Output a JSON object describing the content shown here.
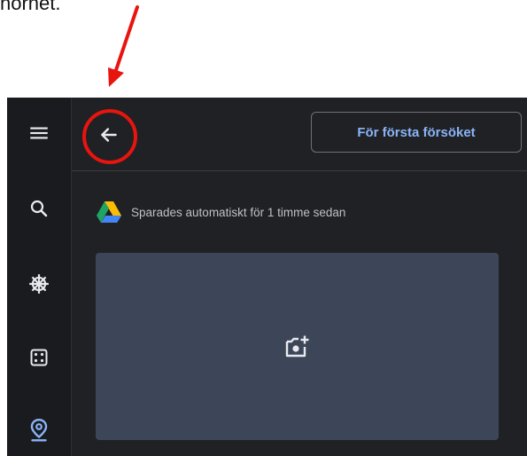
{
  "annotation": {
    "caption_text": "hörnet.",
    "arrow_color": "#e8140f"
  },
  "rail": {
    "items": [
      {
        "icon": "menu-icon"
      },
      {
        "icon": "search-icon"
      },
      {
        "icon": "ship-wheel-icon"
      },
      {
        "icon": "dice-icon"
      },
      {
        "icon": "location-pin-icon",
        "active": true
      }
    ]
  },
  "header": {
    "back_icon": "arrow-left-icon",
    "primary_button_label": "För första försöket"
  },
  "status": {
    "icon": "google-drive-icon",
    "text": "Sparades automatiskt för 1 timme sedan"
  },
  "photo_card": {
    "icon": "add-photo-icon"
  },
  "colors": {
    "background": "#202124",
    "rail": "#1a1b1e",
    "accent": "#8ab4f8",
    "card": "#3c4658"
  }
}
